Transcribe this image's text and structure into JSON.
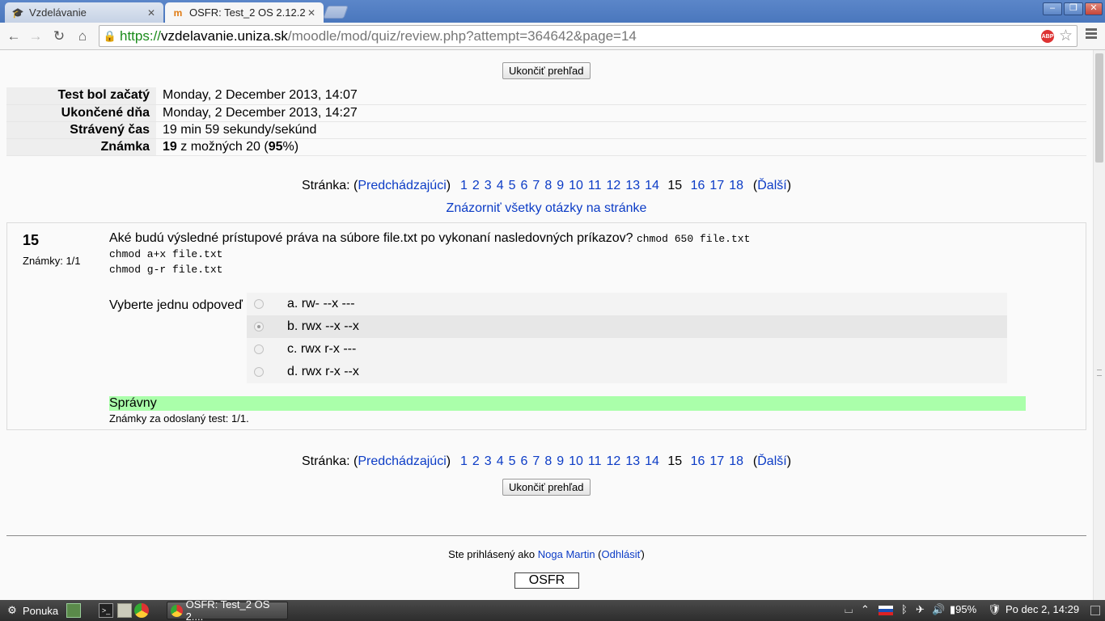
{
  "browser": {
    "tabs": [
      {
        "title": "Vzdelávanie",
        "active": false
      },
      {
        "title": "OSFR: Test_2 OS 2.12.2",
        "active": true
      }
    ],
    "url": {
      "scheme": "https://",
      "host": "vzdelavanie.uniza.sk",
      "path": "/moodle/mod/quiz/review.php?attempt=364642&page=14"
    },
    "abp_label": "ABP"
  },
  "page": {
    "finish_review_label": "Ukončiť prehľad",
    "summary": [
      {
        "label": "Test bol začatý",
        "value": "Monday, 2 December 2013, 14:07"
      },
      {
        "label": "Ukončené dňa",
        "value": "Monday, 2 December 2013, 14:27"
      },
      {
        "label": "Strávený čas",
        "value": "19 min 59 sekundy/sekúnd"
      }
    ],
    "grade": {
      "label": "Známka",
      "score": "19",
      "middle": " z možných 20 (",
      "percent": "95",
      "end": "%)"
    },
    "pager": {
      "label": "Stránka: (",
      "prev": "Predchádzajúci",
      "close_prev": ")",
      "pages_before": [
        "1",
        "2",
        "3",
        "4",
        "5",
        "6",
        "7",
        "8",
        "9",
        "10",
        "11",
        "12",
        "13",
        "14"
      ],
      "current": "15",
      "pages_after": [
        "16",
        "17",
        "18"
      ],
      "open_next": "(",
      "next": "Ďalší",
      "close_next": ")"
    },
    "show_all": "Znázorniť všetky otázky na stránke",
    "question": {
      "number": "15",
      "grade": "Známky: 1/1",
      "text": "Aké budú výsledné prístupové práva na súbore file.txt po vykonaní nasledovných príkazov? ",
      "cmd1": "chmod 650 file.txt",
      "cmd2": "chmod a+x file.txt",
      "cmd3": "chmod g-r file.txt",
      "prompt": "Vyberte jednu odpoveď",
      "answers": [
        {
          "label": "a. rw- --x ---",
          "selected": false
        },
        {
          "label": "b. rwx --x --x",
          "selected": true
        },
        {
          "label": "c. rwx r-x ---",
          "selected": false
        },
        {
          "label": "d. rwx r-x --x",
          "selected": false
        }
      ],
      "feedback": "Správny",
      "marks_note": "Známky za odoslaný test: 1/1."
    },
    "footer": {
      "logged_in_prefix": "Ste prihlásený ako ",
      "user": "Noga Martin",
      "open": " (",
      "logout": "Odhlásiť",
      "close": ")",
      "course": "OSFR"
    }
  },
  "taskbar": {
    "menu_label": "Ponuka",
    "task_title": "OSFR: Test_2 OS 2....",
    "battery": "95%",
    "clock": "Po dec  2, 14:29"
  }
}
